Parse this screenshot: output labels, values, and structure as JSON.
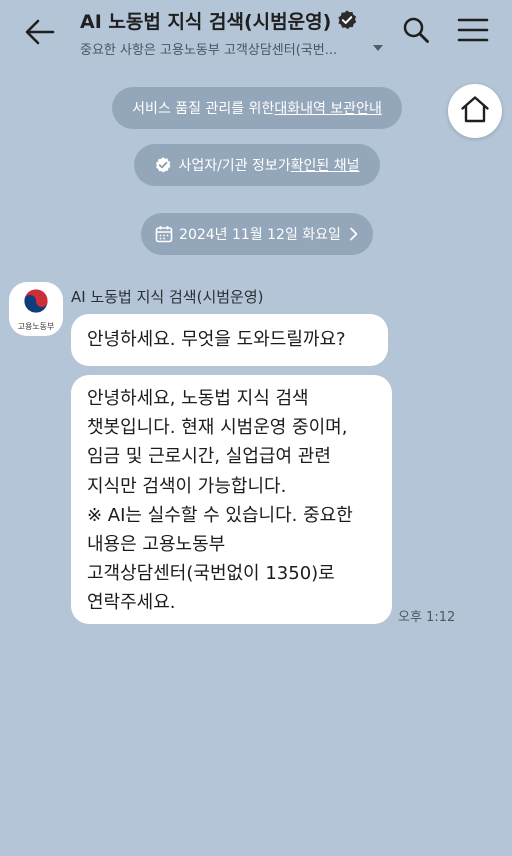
{
  "header": {
    "title": "AI 노동법 지식 검색(시범운영)",
    "subtitle": "중요한 사항은 고용노동부 고객상담센터(국번...",
    "icons": {
      "back": "back-arrow-icon",
      "verified": "verified-badge-icon",
      "subtitle_toggle": "caret-down-icon",
      "search": "search-icon",
      "menu": "hamburger-menu-icon"
    }
  },
  "home_button": {
    "icon": "home-icon"
  },
  "notices": {
    "quality": {
      "prefix": "서비스 품질 관리를 위한 ",
      "link": "대화내역 보관안내"
    },
    "verified": {
      "prefix": "사업자/기관 정보가 ",
      "link": "확인된 채널"
    },
    "date": {
      "text": "2024년 11월 12일 화요일"
    }
  },
  "conversation": {
    "sender": {
      "name": "AI 노동법 지식 검색(시범운영)",
      "avatar_label": "고용노동부"
    },
    "messages": [
      {
        "text": "안녕하세요. 무엇을 도와드릴까요?"
      },
      {
        "lines": [
          "안녕하세요, 노동법 지식 검색",
          "챗봇입니다. 현재 시범운영 중이며,",
          "임금 및 근로시간, 실업급여 관련",
          "지식만 검색이 가능합니다.",
          "※ AI는 실수할 수 있습니다. 중요한",
          "내용은 고용노동부",
          "고객상담센터(국번없이 1350)로",
          "연락주세요."
        ]
      }
    ],
    "time": "오후 1:12"
  },
  "colors": {
    "background": "#b3c5d7",
    "pill": "#8a9cb0",
    "bubble": "#ffffff",
    "emblem_red": "#cd2e3a",
    "emblem_blue": "#0f3c7a"
  }
}
